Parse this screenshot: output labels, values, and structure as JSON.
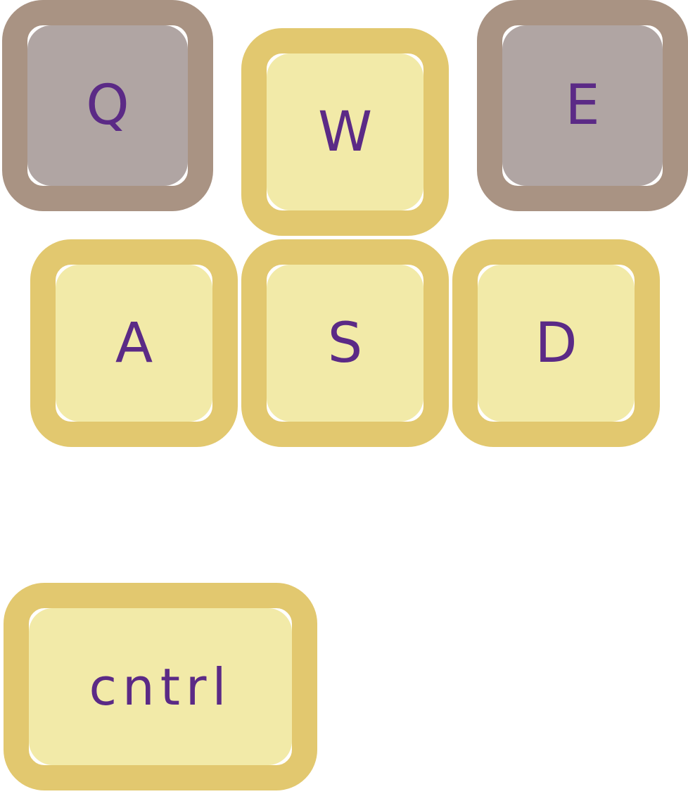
{
  "keys": {
    "q": {
      "label": "Q",
      "state": "inactive"
    },
    "w": {
      "label": "W",
      "state": "active"
    },
    "e": {
      "label": "E",
      "state": "inactive"
    },
    "a": {
      "label": "A",
      "state": "active"
    },
    "s": {
      "label": "S",
      "state": "active"
    },
    "d": {
      "label": "D",
      "state": "active"
    },
    "ctrl": {
      "label": "cntrl",
      "state": "active"
    }
  },
  "colors": {
    "active_border": "#e2c86f",
    "active_face": "#f2eaa8",
    "inactive_border": "#a99383",
    "inactive_face": "#b0a5a3",
    "label": "#5b2a86"
  }
}
